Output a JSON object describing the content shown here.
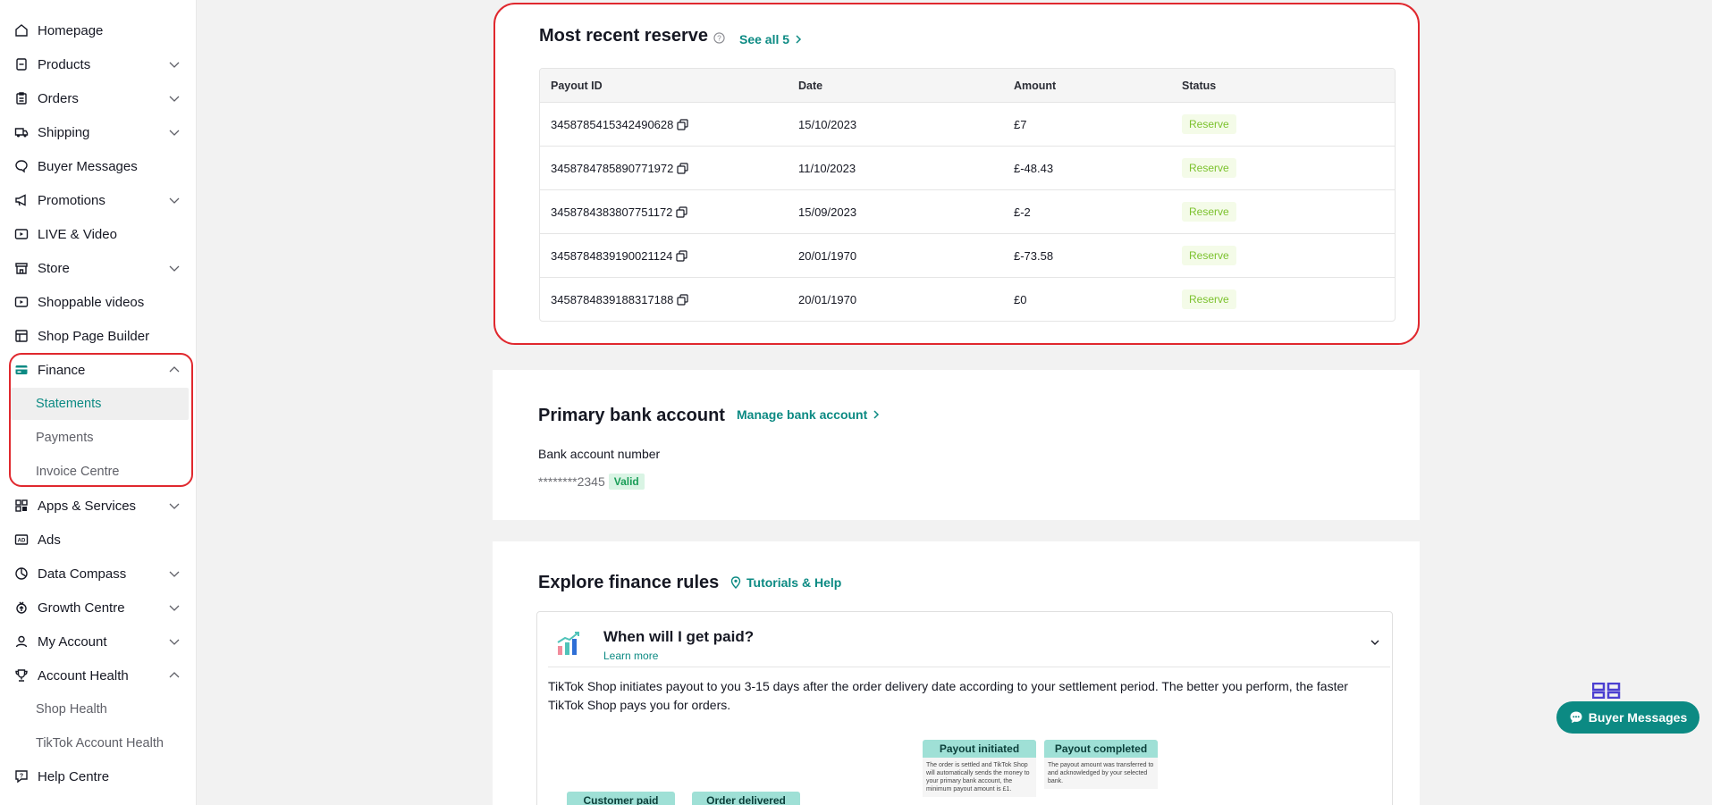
{
  "sidebar": {
    "items": [
      {
        "label": "Homepage",
        "icon": "home-icon",
        "chevron": ""
      },
      {
        "label": "Products",
        "icon": "box-icon",
        "chevron": "down"
      },
      {
        "label": "Orders",
        "icon": "clipboard-icon",
        "chevron": "down"
      },
      {
        "label": "Shipping",
        "icon": "truck-icon",
        "chevron": "down"
      },
      {
        "label": "Buyer Messages",
        "icon": "chat-icon",
        "chevron": ""
      },
      {
        "label": "Promotions",
        "icon": "megaphone-icon",
        "chevron": "down"
      },
      {
        "label": "LIVE & Video",
        "icon": "video-icon",
        "chevron": ""
      },
      {
        "label": "Store",
        "icon": "store-icon",
        "chevron": "down"
      },
      {
        "label": "Shoppable videos",
        "icon": "play-icon",
        "chevron": ""
      },
      {
        "label": "Shop Page Builder",
        "icon": "layout-icon",
        "chevron": ""
      },
      {
        "label": "Finance",
        "icon": "card-icon",
        "chevron": "up"
      },
      {
        "label": "Apps & Services",
        "icon": "grid-icon",
        "chevron": "down"
      },
      {
        "label": "Ads",
        "icon": "ad-icon",
        "chevron": ""
      },
      {
        "label": "Data Compass",
        "icon": "chart-icon",
        "chevron": "down"
      },
      {
        "label": "Growth Centre",
        "icon": "growth-icon",
        "chevron": "down"
      },
      {
        "label": "My Account",
        "icon": "user-icon",
        "chevron": "down"
      },
      {
        "label": "Account Health",
        "icon": "trophy-icon",
        "chevron": "up"
      },
      {
        "label": "Help Centre",
        "icon": "help-icon",
        "chevron": ""
      }
    ],
    "finance_sub": [
      "Statements",
      "Payments",
      "Invoice Centre"
    ],
    "health_sub": [
      "Shop Health",
      "TikTok Account Health"
    ]
  },
  "reserve": {
    "title": "Most recent reserve",
    "see_all": "See all 5",
    "columns": [
      "Payout ID",
      "Date",
      "Amount",
      "Status"
    ],
    "rows": [
      {
        "id": "3458785415342490628",
        "date": "15/10/2023",
        "amount": "£7",
        "status": "Reserve"
      },
      {
        "id": "3458784785890771972",
        "date": "11/10/2023",
        "amount": "£-48.43",
        "status": "Reserve"
      },
      {
        "id": "3458784383807751172",
        "date": "15/09/2023",
        "amount": "£-2",
        "status": "Reserve"
      },
      {
        "id": "3458784839190021124",
        "date": "20/01/1970",
        "amount": "£-73.58",
        "status": "Reserve"
      },
      {
        "id": "3458784839188317188",
        "date": "20/01/1970",
        "amount": "£0",
        "status": "Reserve"
      }
    ]
  },
  "bank": {
    "title": "Primary bank account",
    "manage_link": "Manage bank account",
    "label": "Bank account number",
    "number": "********2345",
    "status": "Valid"
  },
  "rules": {
    "title": "Explore finance rules",
    "help_link": "Tutorials & Help",
    "faq_title": "When will I get paid?",
    "learn_more": "Learn more",
    "faq_text": "TikTok Shop initiates payout to you 3-15 days after the order delivery date according to your settlement period. The better you perform, the faster TikTok Shop pays you for orders.",
    "flow": {
      "customer_paid": "Customer paid",
      "order_delivered": "Order delivered",
      "payout_initiated": "Payout initiated",
      "payout_initiated_text": "The order is settled and TikTok Shop will automatically sends the money to your primary bank account, the minimum payout amount is £1.",
      "payout_completed": "Payout completed",
      "payout_completed_text": "The payout amount was transferred to and acknowledged by your selected bank."
    }
  },
  "floating": {
    "label": "Buyer Messages"
  }
}
